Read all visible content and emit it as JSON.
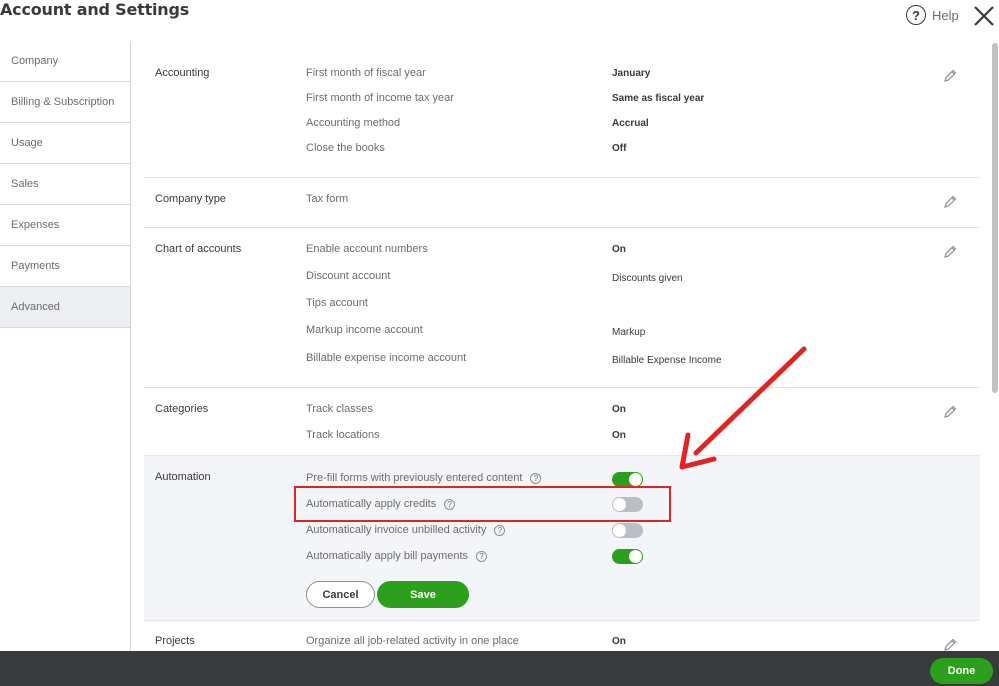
{
  "header": {
    "title": "Account and Settings",
    "help_label": "Help"
  },
  "sidebar": {
    "items": [
      {
        "label": "Company"
      },
      {
        "label": "Billing & Subscription"
      },
      {
        "label": "Usage"
      },
      {
        "label": "Sales"
      },
      {
        "label": "Expenses"
      },
      {
        "label": "Payments"
      },
      {
        "label": "Advanced",
        "active": true
      }
    ]
  },
  "sections": {
    "accounting": {
      "label": "Accounting",
      "rows": [
        {
          "name": "First month of fiscal year",
          "value": "January"
        },
        {
          "name": "First month of income tax year",
          "value": "Same as fiscal year"
        },
        {
          "name": "Accounting method",
          "value": "Accrual"
        },
        {
          "name": "Close the books",
          "value": "Off"
        }
      ]
    },
    "company_type": {
      "label": "Company type",
      "rows": [
        {
          "name": "Tax form",
          "value": ""
        }
      ]
    },
    "chart_of_accounts": {
      "label": "Chart of accounts",
      "rows": [
        {
          "name": "Enable account numbers",
          "value": "On"
        },
        {
          "name": "Discount account",
          "value": "Discounts given"
        },
        {
          "name": "Tips account",
          "value": ""
        },
        {
          "name": "Markup income account",
          "value": "Markup"
        },
        {
          "name": "Billable expense income account",
          "value": "Billable Expense Income"
        }
      ]
    },
    "categories": {
      "label": "Categories",
      "rows": [
        {
          "name": "Track classes",
          "value": "On"
        },
        {
          "name": "Track locations",
          "value": "On"
        }
      ]
    },
    "automation": {
      "label": "Automation",
      "rows": [
        {
          "name": "Pre-fill forms with previously entered content",
          "on": true
        },
        {
          "name": "Automatically apply credits",
          "on": false
        },
        {
          "name": "Automatically invoice unbilled activity",
          "on": false
        },
        {
          "name": "Automatically apply bill payments",
          "on": true
        }
      ],
      "cancel_label": "Cancel",
      "save_label": "Save"
    },
    "projects": {
      "label": "Projects",
      "rows": [
        {
          "name": "Organize all job-related activity in one place",
          "value": "On"
        }
      ]
    }
  },
  "footer": {
    "done_label": "Done"
  },
  "colors": {
    "green": "#2ca01c",
    "annotation_red": "#e02424",
    "footer_bg": "#393a3d"
  }
}
